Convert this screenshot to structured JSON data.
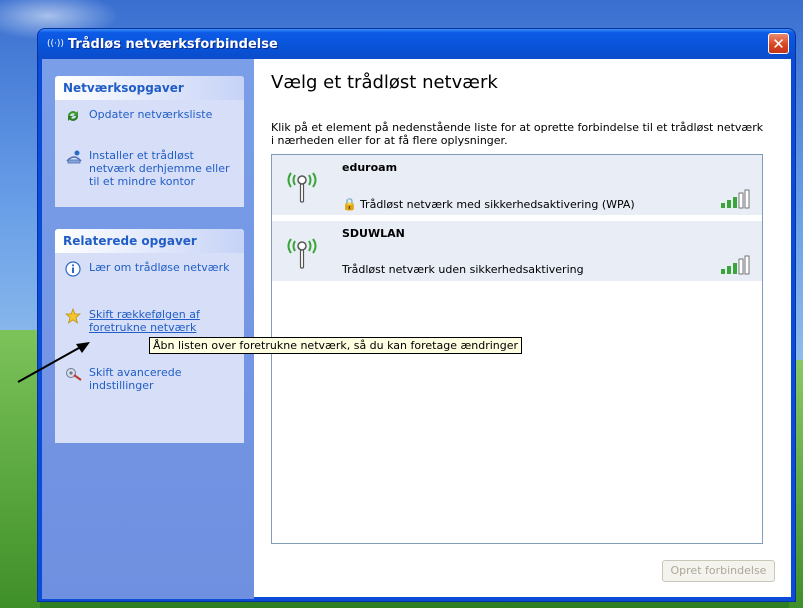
{
  "window": {
    "title": "Trådløs netværksforbindelse",
    "title_icon": "wireless-signal-icon",
    "close_glyph": "✕"
  },
  "sidebar": {
    "groups": [
      {
        "title": "Netværksopgaver",
        "items": [
          {
            "label": "Opdater netværksliste",
            "icon": "refresh-icon"
          },
          {
            "label": "Installer et trådløst netværk derhjemme eller til et mindre kontor",
            "icon": "setup-wizard-icon"
          }
        ]
      },
      {
        "title": "Relaterede opgaver",
        "items": [
          {
            "label": "Lær om trådløse netværk",
            "icon": "info-icon"
          },
          {
            "label": "Skift rækkefølgen af foretrukne netværk",
            "icon": "star-icon"
          },
          {
            "label": "Skift avancerede indstillinger",
            "icon": "settings-icon"
          }
        ]
      }
    ]
  },
  "main": {
    "heading": "Vælg et trådløst netværk",
    "description": "Klik på et element på nedenstående liste for at oprette forbindelse til et trådløst netværk i nærheden eller for at få flere oplysninger.",
    "networks": [
      {
        "name": "eduroam",
        "security": "Trådløst netværk med sikkerhedsaktivering (WPA)",
        "secured": true,
        "signal_bars": 5
      },
      {
        "name": "SDUWLAN",
        "security": "Trådløst netværk uden sikkerhedsaktivering",
        "secured": false,
        "signal_bars": 5
      }
    ],
    "connect_button": "Opret forbindelse"
  },
  "tooltip": "Åbn listen over foretrukne netværk, så du kan foretage ændringer",
  "colors": {
    "titlebar": "#0853d8",
    "task_link": "#215dc6",
    "tooltip_bg": "#ffffe1",
    "signal_green": "#3aa53a"
  }
}
